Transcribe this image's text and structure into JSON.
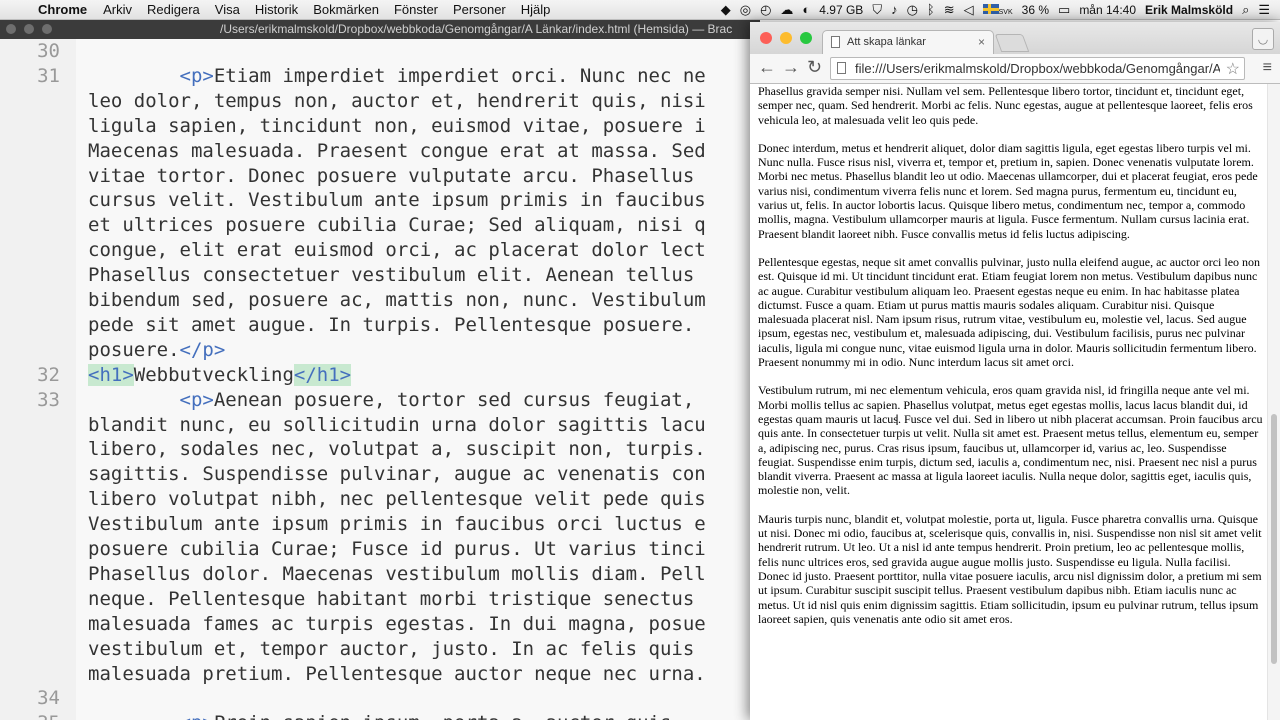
{
  "menubar": {
    "app": "Chrome",
    "menus": [
      "Arkiv",
      "Redigera",
      "Visa",
      "Historik",
      "Bokmärken",
      "Fönster",
      "Personer",
      "Hjälp"
    ],
    "memory": "4.97 GB",
    "flag_label": "SVK",
    "battery": "36 %",
    "clock": "mån 14:40",
    "user": "Erik Malmsköld"
  },
  "editor": {
    "title": "/Users/erikmalmskold/Dropbox/webbkoda/Genomgångar/A Länkar/index.html (Hemsida) — Brac",
    "lines": [
      {
        "num": "30",
        "text": ""
      },
      {
        "num": "31",
        "text": "        <p>Etiam imperdiet imperdiet orci. Nunc nec ne"
      },
      {
        "num": "",
        "text": "leo dolor, tempus non, auctor et, hendrerit quis, nisi"
      },
      {
        "num": "",
        "text": "ligula sapien, tincidunt non, euismod vitae, posuere i"
      },
      {
        "num": "",
        "text": "Maecenas malesuada. Praesent congue erat at massa. Sed"
      },
      {
        "num": "",
        "text": "vitae tortor. Donec posuere vulputate arcu. Phasellus"
      },
      {
        "num": "",
        "text": "cursus velit. Vestibulum ante ipsum primis in faucibus"
      },
      {
        "num": "",
        "text": "et ultrices posuere cubilia Curae; Sed aliquam, nisi q"
      },
      {
        "num": "",
        "text": "congue, elit erat euismod orci, ac placerat dolor lect"
      },
      {
        "num": "",
        "text": "Phasellus consectetuer vestibulum elit. Aenean tellus"
      },
      {
        "num": "",
        "text": "bibendum sed, posuere ac, mattis non, nunc. Vestibulum"
      },
      {
        "num": "",
        "text": "pede sit amet augue. In turpis. Pellentesque posuere."
      },
      {
        "num": "",
        "text": "posuere.</p>"
      },
      {
        "num": "32",
        "text": "<h1>Webbutveckling</h1>"
      },
      {
        "num": "33",
        "text": "        <p>Aenean posuere, tortor sed cursus feugiat,"
      },
      {
        "num": "",
        "text": "blandit nunc, eu sollicitudin urna dolor sagittis lacu"
      },
      {
        "num": "",
        "text": "libero, sodales nec, volutpat a, suscipit non, turpis."
      },
      {
        "num": "",
        "text": "sagittis. Suspendisse pulvinar, augue ac venenatis con"
      },
      {
        "num": "",
        "text": "libero volutpat nibh, nec pellentesque velit pede quis"
      },
      {
        "num": "",
        "text": "Vestibulum ante ipsum primis in faucibus orci luctus e"
      },
      {
        "num": "",
        "text": "posuere cubilia Curae; Fusce id purus. Ut varius tinci"
      },
      {
        "num": "",
        "text": "Phasellus dolor. Maecenas vestibulum mollis diam. Pell"
      },
      {
        "num": "",
        "text": "neque. Pellentesque habitant morbi tristique senectus"
      },
      {
        "num": "",
        "text": "malesuada fames ac turpis egestas. In dui magna, posue"
      },
      {
        "num": "",
        "text": "vestibulum et, tempor auctor, justo. In ac felis quis"
      },
      {
        "num": "",
        "text": "malesuada pretium. Pellentesque auctor neque nec urna."
      },
      {
        "num": "34",
        "text": ""
      },
      {
        "num": "35",
        "text": "        <p>Proin sapien ipsum, porta a, auctor quis,"
      }
    ]
  },
  "browser": {
    "tab_title": "Att skapa länkar",
    "url": "file:///Users/erikmalmskold/Dropbox/webbkoda/Genomgångar/A Länkar/index.html",
    "paragraphs": [
      "Phasellus gravida semper nisi. Nullam vel sem. Pellentesque libero tortor, tincidunt et, tincidunt eget, semper nec, quam. Sed hendrerit. Morbi ac felis. Nunc egestas, augue at pellentesque laoreet, felis eros vehicula leo, at malesuada velit leo quis pede.",
      "Donec interdum, metus et hendrerit aliquet, dolor diam sagittis ligula, eget egestas libero turpis vel mi. Nunc nulla. Fusce risus nisl, viverra et, tempor et, pretium in, sapien. Donec venenatis vulputate lorem. Morbi nec metus. Phasellus blandit leo ut odio. Maecenas ullamcorper, dui et placerat feugiat, eros pede varius nisi, condimentum viverra felis nunc et lorem. Sed magna purus, fermentum eu, tincidunt eu, varius ut, felis. In auctor lobortis lacus. Quisque libero metus, condimentum nec, tempor a, commodo mollis, magna. Vestibulum ullamcorper mauris at ligula. Fusce fermentum. Nullam cursus lacinia erat. Praesent blandit laoreet nibh. Fusce convallis metus id felis luctus adipiscing.",
      "Pellentesque egestas, neque sit amet convallis pulvinar, justo nulla eleifend augue, ac auctor orci leo non est. Quisque id mi. Ut tincidunt tincidunt erat. Etiam feugiat lorem non metus. Vestibulum dapibus nunc ac augue. Curabitur vestibulum aliquam leo. Praesent egestas neque eu enim. In hac habitasse platea dictumst. Fusce a quam. Etiam ut purus mattis mauris sodales aliquam. Curabitur nisi. Quisque malesuada placerat nisl. Nam ipsum risus, rutrum vitae, vestibulum eu, molestie vel, lacus. Sed augue ipsum, egestas nec, vestibulum et, malesuada adipiscing, dui. Vestibulum facilisis, purus nec pulvinar iaculis, ligula mi congue nunc, vitae euismod ligula urna in dolor. Mauris sollicitudin fermentum libero. Praesent nonummy mi in odio. Nunc interdum lacus sit amet orci.",
      "Vestibulum rutrum, mi nec elementum vehicula, eros quam gravida nisl, id fringilla neque ante vel mi. Morbi mollis tellus ac sapien. Phasellus volutpat, metus eget egestas mollis, lacus lacus blandit dui, id egestas quam mauris ut lacus. Fusce vel dui. Sed in libero ut nibh placerat accumsan. Proin faucibus arcu quis ante. In consectetuer turpis ut velit. Nulla sit amet est. Praesent metus tellus, elementum eu, semper a, adipiscing nec, purus. Cras risus ipsum, faucibus ut, ullamcorper id, varius ac, leo. Suspendisse feugiat. Suspendisse enim turpis, dictum sed, iaculis a, condimentum nec, nisi. Praesent nec nisl a purus blandit viverra. Praesent ac massa at ligula laoreet iaculis. Nulla neque dolor, sagittis eget, iaculis quis, molestie non, velit.",
      "Mauris turpis nunc, blandit et, volutpat molestie, porta ut, ligula. Fusce pharetra convallis urna. Quisque ut nisi. Donec mi odio, faucibus at, scelerisque quis, convallis in, nisi. Suspendisse non nisl sit amet velit hendrerit rutrum. Ut leo. Ut a nisl id ante tempus hendrerit. Proin pretium, leo ac pellentesque mollis, felis nunc ultrices eros, sed gravida augue augue mollis justo. Suspendisse eu ligula. Nulla facilisi. Donec id justo. Praesent porttitor, nulla vitae posuere iaculis, arcu nisl dignissim dolor, a pretium mi sem ut ipsum. Curabitur suscipit suscipit tellus. Praesent vestibulum dapibus nibh. Etiam iaculis nunc ac metus. Ut id nisl quis enim dignissim sagittis. Etiam sollicitudin, ipsum eu pulvinar rutrum, tellus ipsum laoreet sapien, quis venenatis ante odio sit amet eros."
    ]
  }
}
